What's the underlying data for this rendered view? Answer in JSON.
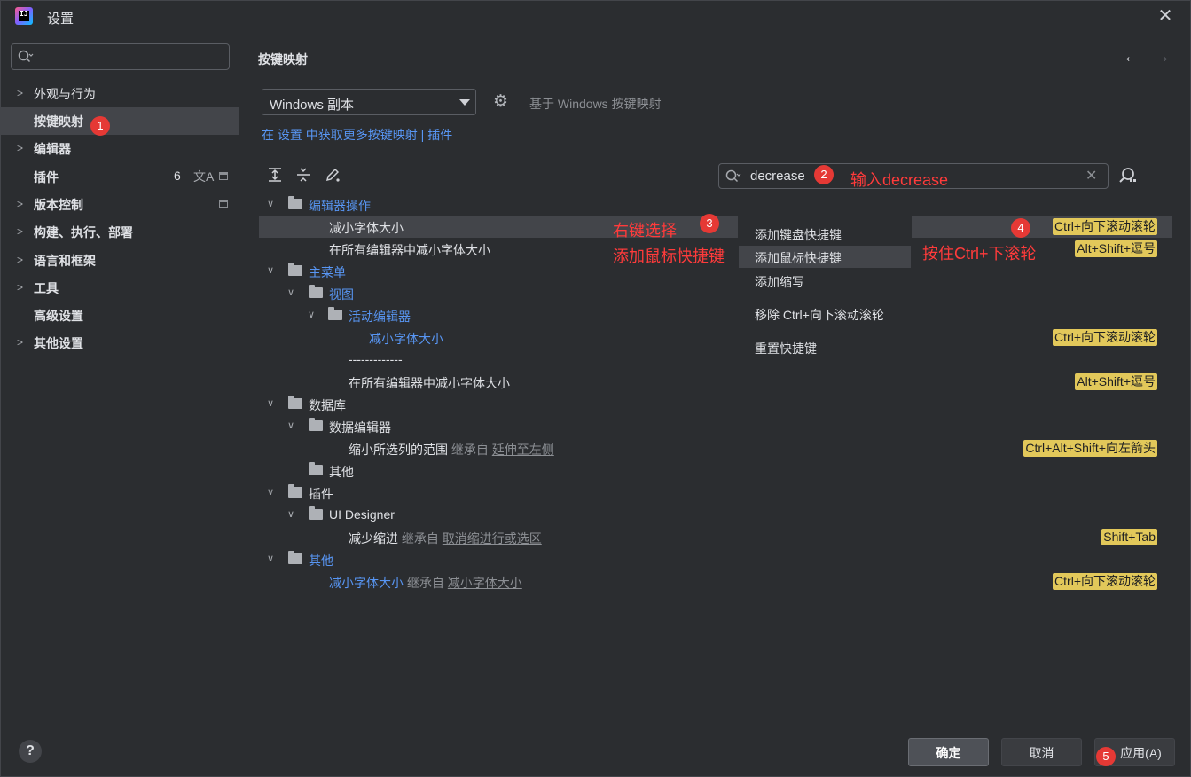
{
  "window": {
    "title": "设置"
  },
  "left": {
    "search_placeholder": "",
    "items": [
      {
        "label": "外观与行为",
        "expandable": true
      },
      {
        "label": "按键映射",
        "expandable": false,
        "selected": true
      },
      {
        "label": "编辑器",
        "expandable": true
      },
      {
        "label": "插件",
        "expandable": false,
        "count": "6"
      },
      {
        "label": "版本控制",
        "expandable": true
      },
      {
        "label": "构建、执行、部署",
        "expandable": true
      },
      {
        "label": "语言和框架",
        "expandable": true
      },
      {
        "label": "工具",
        "expandable": true
      },
      {
        "label": "高级设置",
        "expandable": false
      },
      {
        "label": "其他设置",
        "expandable": true
      }
    ]
  },
  "main": {
    "title": "按键映射",
    "keymap_selected": "Windows 副本",
    "based_on": "基于 Windows 按键映射",
    "link_prefix": "在 设置 中获取更多按键映射",
    "link_sep": " | ",
    "link_plugins": "插件",
    "search_value": "decrease"
  },
  "tree": [
    {
      "label": "编辑器操作",
      "blue": true
    },
    {
      "label": "减小字体大小"
    },
    {
      "label": "在所有编辑器中减小字体大小",
      "shortcut": "Alt+Shift+逗号"
    },
    {
      "label": "主菜单",
      "blue": true
    },
    {
      "label": "视图",
      "blue": true
    },
    {
      "label": "活动编辑器",
      "blue": true
    },
    {
      "label": "减小字体大小",
      "blue": true,
      "shortcut": "Ctrl+向下滚动滚轮"
    },
    {
      "label": "-------------"
    },
    {
      "label": "在所有编辑器中减小字体大小",
      "shortcut": "Alt+Shift+逗号"
    },
    {
      "label": "数据库"
    },
    {
      "label": "数据编辑器"
    },
    {
      "label": "缩小所选列的范围",
      "inherit_prefix": "继承自",
      "inherit_link": "延伸至左侧",
      "shortcut": "Ctrl+Alt+Shift+向左箭头"
    },
    {
      "label": "其他"
    },
    {
      "label": "插件"
    },
    {
      "label": "UI Designer"
    },
    {
      "label": "减少缩进",
      "inherit_prefix": "继承自",
      "inherit_link": "取消缩进行或选区",
      "shortcut": "Shift+Tab"
    },
    {
      "label": "其他",
      "blue": true
    },
    {
      "label": "减小字体大小",
      "blue": true,
      "inherit_prefix": "继承自",
      "inherit_link": "减小字体大小",
      "shortcut": "Ctrl+向下滚动滚轮"
    }
  ],
  "first_row_shortcut": "Ctrl+向下滚动滚轮",
  "context_menu": [
    {
      "label": "添加键盘快捷键"
    },
    {
      "label": "添加鼠标快捷键",
      "selected": true
    },
    {
      "label": "添加缩写"
    },
    {
      "label": "移除 Ctrl+向下滚动滚轮"
    },
    {
      "label": "重置快捷键"
    }
  ],
  "annotations": {
    "badges": [
      "1",
      "2",
      "3",
      "4",
      "5"
    ],
    "note_search": "输入decrease",
    "note_right_click_1": "右键选择",
    "note_right_click_2": "添加鼠标快捷键",
    "note_hold": "按住Ctrl+下滚轮",
    "color": "#ff3b3b"
  },
  "footer": {
    "help": "?",
    "ok": "确定",
    "cancel": "取消",
    "apply": "应用(A)"
  }
}
